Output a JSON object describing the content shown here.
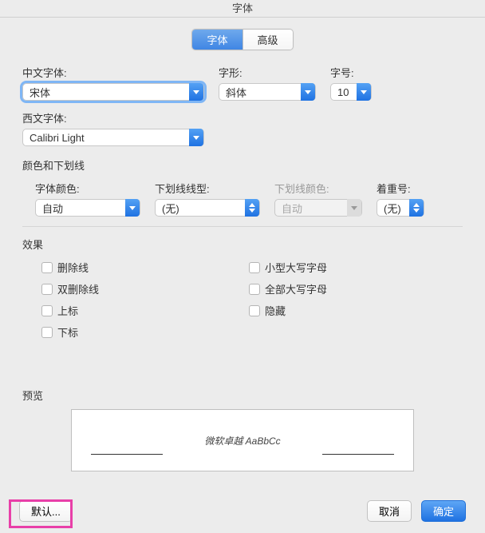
{
  "title": "字体",
  "tabs": {
    "font": "字体",
    "advanced": "高级",
    "active": "font"
  },
  "labels": {
    "chinese_font": "中文字体:",
    "style": "字形:",
    "size": "字号:",
    "western_font": "西文字体:",
    "color_underline": "颜色和下划线",
    "font_color": "字体颜色:",
    "underline_style": "下划线线型:",
    "underline_color": "下划线颜色:",
    "emphasis": "着重号:",
    "effects": "效果",
    "preview": "预览"
  },
  "values": {
    "chinese_font": "宋体",
    "style": "斜体",
    "size": "10",
    "western_font": "Calibri Light",
    "font_color": "自动",
    "underline_style": "(无)",
    "underline_color": "自动",
    "emphasis": "(无)"
  },
  "effects": {
    "col1": [
      "删除线",
      "双删除线",
      "上标",
      "下标"
    ],
    "col2": [
      "小型大写字母",
      "全部大写字母",
      "隐藏"
    ]
  },
  "preview_text": "微软卓越 AaBbCc",
  "buttons": {
    "default": "默认...",
    "cancel": "取消",
    "ok": "确定"
  }
}
